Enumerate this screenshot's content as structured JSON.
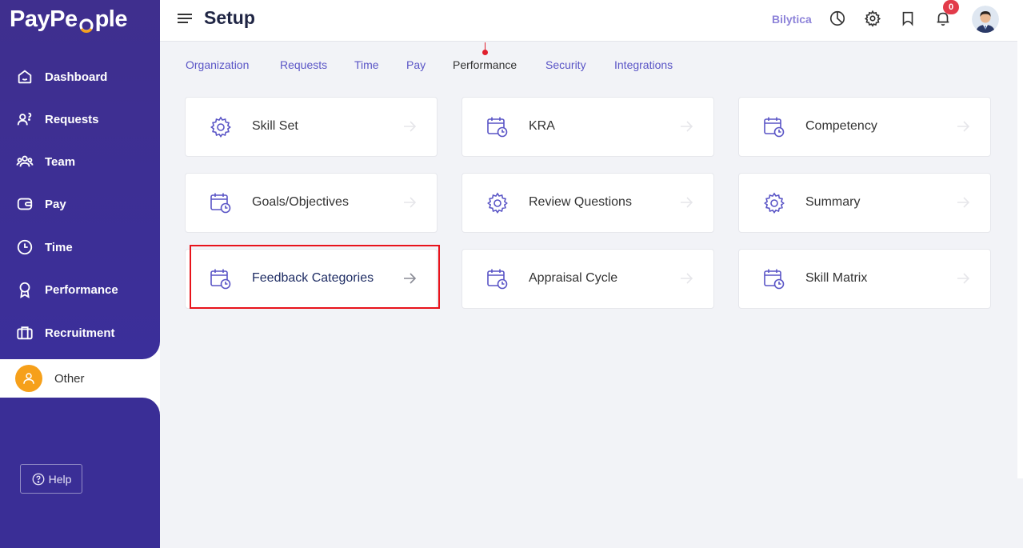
{
  "app": {
    "logo": "PayPeople"
  },
  "header": {
    "title": "Setup",
    "company": "Bilytica",
    "notification_count": "0"
  },
  "sidebar": {
    "items": [
      {
        "label": "Dashboard"
      },
      {
        "label": "Requests"
      },
      {
        "label": "Team"
      },
      {
        "label": "Pay"
      },
      {
        "label": "Time"
      },
      {
        "label": "Performance"
      },
      {
        "label": "Recruitment"
      }
    ],
    "other_label": "Other",
    "help_label": "Help"
  },
  "tabs": [
    {
      "label": "Organization"
    },
    {
      "label": "Requests"
    },
    {
      "label": "Time"
    },
    {
      "label": "Pay"
    },
    {
      "label": "Performance",
      "active": true
    },
    {
      "label": "Security"
    },
    {
      "label": "Integrations"
    }
  ],
  "cards": [
    {
      "label": "Skill Set",
      "icon": "gear-icon"
    },
    {
      "label": "KRA",
      "icon": "calendar-clock-icon"
    },
    {
      "label": "Competency",
      "icon": "calendar-clock-icon"
    },
    {
      "label": "Goals/Objectives",
      "icon": "calendar-clock-icon"
    },
    {
      "label": "Review Questions",
      "icon": "gear-icon"
    },
    {
      "label": "Summary",
      "icon": "gear-icon"
    },
    {
      "label": "Feedback Categories",
      "icon": "calendar-clock-icon",
      "highlighted": true
    },
    {
      "label": "Appraisal Cycle",
      "icon": "calendar-clock-icon"
    },
    {
      "label": "Skill Matrix",
      "icon": "calendar-clock-icon"
    }
  ],
  "colors": {
    "sidebar": "#3b2f9a",
    "accent": "#5a55c6",
    "highlight": "#e8131b",
    "badge": "#e23b4a"
  }
}
